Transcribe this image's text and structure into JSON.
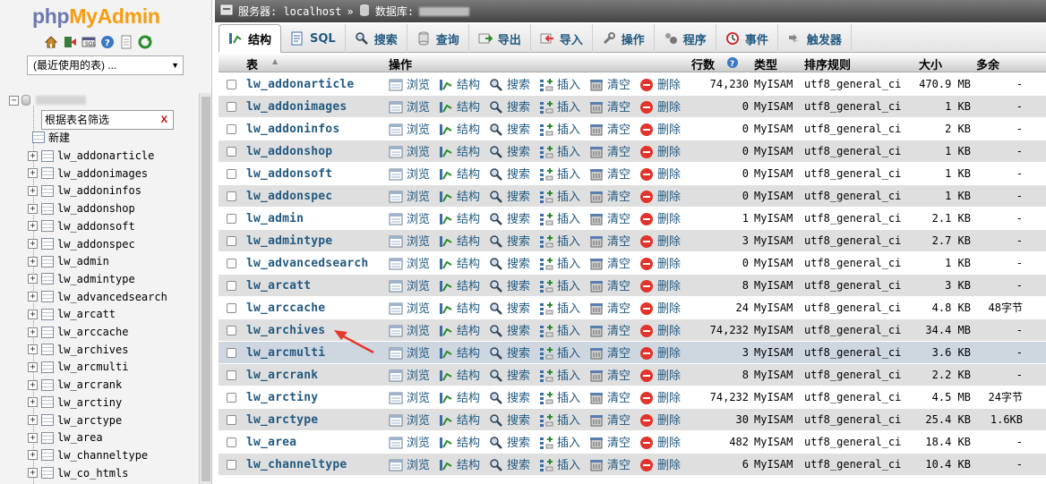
{
  "logo": {
    "part1": "php",
    "part2": "MyAdmin"
  },
  "recent": {
    "label": "(最近使用的表) ..."
  },
  "navtree": {
    "filter_placeholder": "根据表名筛选",
    "filter_clear": "X",
    "new_label": "新建",
    "tables": [
      "lw_addonarticle",
      "lw_addonimages",
      "lw_addoninfos",
      "lw_addonshop",
      "lw_addonsoft",
      "lw_addonspec",
      "lw_admin",
      "lw_admintype",
      "lw_advancedsearch",
      "lw_arcatt",
      "lw_arccache",
      "lw_archives",
      "lw_arcmulti",
      "lw_arcrank",
      "lw_arctiny",
      "lw_arctype",
      "lw_area",
      "lw_channeltype",
      "lw_co_htmls"
    ]
  },
  "breadcrumb": {
    "server_label": "服务器: localhost",
    "sep": "»",
    "db_label": "数据库:"
  },
  "tabs": [
    {
      "label": "结构",
      "icon": "structure-icon"
    },
    {
      "label": "SQL",
      "icon": "sql-icon"
    },
    {
      "label": "搜索",
      "icon": "search-icon"
    },
    {
      "label": "查询",
      "icon": "query-icon"
    },
    {
      "label": "导出",
      "icon": "export-icon"
    },
    {
      "label": "导入",
      "icon": "import-icon"
    },
    {
      "label": "操作",
      "icon": "wrench-icon"
    },
    {
      "label": "程序",
      "icon": "routines-icon"
    },
    {
      "label": "事件",
      "icon": "events-icon"
    },
    {
      "label": "触发器",
      "icon": "triggers-icon"
    }
  ],
  "table_header": {
    "table": "表",
    "action": "操作",
    "rows": "行数",
    "type": "类型",
    "collation": "排序规则",
    "size": "大小",
    "overhead": "多余"
  },
  "actions": {
    "browse": "浏览",
    "structure": "结构",
    "search": "搜索",
    "insert": "插入",
    "empty": "清空",
    "drop": "删除"
  },
  "rows": [
    {
      "name": "lw_addonarticle",
      "rows": "74,230",
      "type": "MyISAM",
      "collation": "utf8_general_ci",
      "size": "470.9 MB",
      "overhead": "-"
    },
    {
      "name": "lw_addonimages",
      "rows": "0",
      "type": "MyISAM",
      "collation": "utf8_general_ci",
      "size": "1 KB",
      "overhead": "-"
    },
    {
      "name": "lw_addoninfos",
      "rows": "0",
      "type": "MyISAM",
      "collation": "utf8_general_ci",
      "size": "2 KB",
      "overhead": "-"
    },
    {
      "name": "lw_addonshop",
      "rows": "0",
      "type": "MyISAM",
      "collation": "utf8_general_ci",
      "size": "1 KB",
      "overhead": "-"
    },
    {
      "name": "lw_addonsoft",
      "rows": "0",
      "type": "MyISAM",
      "collation": "utf8_general_ci",
      "size": "1 KB",
      "overhead": "-"
    },
    {
      "name": "lw_addonspec",
      "rows": "0",
      "type": "MyISAM",
      "collation": "utf8_general_ci",
      "size": "1 KB",
      "overhead": "-"
    },
    {
      "name": "lw_admin",
      "rows": "1",
      "type": "MyISAM",
      "collation": "utf8_general_ci",
      "size": "2.1 KB",
      "overhead": "-"
    },
    {
      "name": "lw_admintype",
      "rows": "3",
      "type": "MyISAM",
      "collation": "utf8_general_ci",
      "size": "2.7 KB",
      "overhead": "-"
    },
    {
      "name": "lw_advancedsearch",
      "rows": "0",
      "type": "MyISAM",
      "collation": "utf8_general_ci",
      "size": "1 KB",
      "overhead": "-"
    },
    {
      "name": "lw_arcatt",
      "rows": "8",
      "type": "MyISAM",
      "collation": "utf8_general_ci",
      "size": "3 KB",
      "overhead": "-"
    },
    {
      "name": "lw_arccache",
      "rows": "24",
      "type": "MyISAM",
      "collation": "utf8_general_ci",
      "size": "4.8 KB",
      "overhead": "48字节"
    },
    {
      "name": "lw_archives",
      "rows": "74,232",
      "type": "MyISAM",
      "collation": "utf8_general_ci",
      "size": "34.4 MB",
      "overhead": "-"
    },
    {
      "name": "lw_arcmulti",
      "rows": "3",
      "type": "MyISAM",
      "collation": "utf8_general_ci",
      "size": "3.6 KB",
      "overhead": "-"
    },
    {
      "name": "lw_arcrank",
      "rows": "8",
      "type": "MyISAM",
      "collation": "utf8_general_ci",
      "size": "2.2 KB",
      "overhead": "-"
    },
    {
      "name": "lw_arctiny",
      "rows": "74,232",
      "type": "MyISAM",
      "collation": "utf8_general_ci",
      "size": "4.5 MB",
      "overhead": "24字节"
    },
    {
      "name": "lw_arctype",
      "rows": "30",
      "type": "MyISAM",
      "collation": "utf8_general_ci",
      "size": "25.4 KB",
      "overhead": "1.6KB"
    },
    {
      "name": "lw_area",
      "rows": "482",
      "type": "MyISAM",
      "collation": "utf8_general_ci",
      "size": "18.4 KB",
      "overhead": "-"
    },
    {
      "name": "lw_channeltype",
      "rows": "6",
      "type": "MyISAM",
      "collation": "utf8_general_ci",
      "size": "10.4 KB",
      "overhead": "-"
    }
  ],
  "colors": {
    "link": "#235a81",
    "row_alt": "#dfdfdf",
    "row_hover": "#ced6e0",
    "annotation_arrow": "#e8372c"
  }
}
